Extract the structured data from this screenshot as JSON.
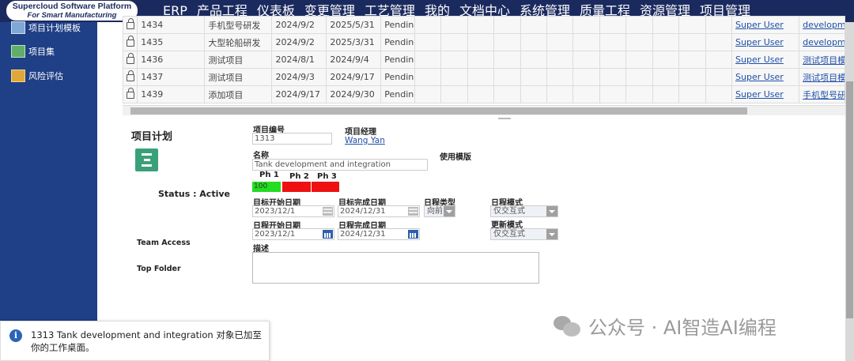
{
  "brand": {
    "line1": "Supercloud Software Platform",
    "line2": "For Smart Manufacturing"
  },
  "top_menu": [
    "ERP",
    "产品工程",
    "仪表板",
    "变更管理",
    "工艺管理",
    "我的",
    "文档中心",
    "系统管理",
    "质量工程",
    "资源管理",
    "项目管理"
  ],
  "sidebar": {
    "items": [
      {
        "label": "项目计划模板",
        "icon": "template-icon"
      },
      {
        "label": "项目集",
        "icon": "program-icon"
      },
      {
        "label": "风险评估",
        "icon": "risk-icon"
      }
    ]
  },
  "table": {
    "rows": [
      {
        "id": "1434",
        "name": "手机型号研发",
        "start": "2024/9/2",
        "end": "2025/5/31",
        "state": "Pending",
        "owner": "Super User",
        "template": "developme"
      },
      {
        "id": "1435",
        "name": "大型轮船研发",
        "start": "2024/9/2",
        "end": "2025/3/31",
        "state": "Pending",
        "owner": "Super User",
        "template": "developme"
      },
      {
        "id": "1436",
        "name": "测试项目",
        "start": "2024/8/1",
        "end": "2024/9/4",
        "state": "Pending",
        "owner": "Super User",
        "template": "测试项目模"
      },
      {
        "id": "1437",
        "name": "测试项目",
        "start": "2024/9/3",
        "end": "2024/9/17",
        "state": "Pending",
        "owner": "Super User",
        "template": "测试项目模"
      },
      {
        "id": "1439",
        "name": "添加项目",
        "start": "2024/9/17",
        "end": "2024/9/30",
        "state": "Pending",
        "owner": "Super User",
        "template": "手机型号研"
      }
    ]
  },
  "form": {
    "section_title": "项目计划",
    "status_label": "Status : Active",
    "team_access_label": "Team Access",
    "top_folder_label": "Top Folder",
    "project_no_label": "项目编号",
    "project_no_value": "1313",
    "manager_label": "项目经理",
    "manager_value": "Wang Yan",
    "name_label": "名称",
    "name_value": "Tank development and integration",
    "use_template_label": "使用模版",
    "phases": [
      {
        "label": "Ph 1",
        "value": "100",
        "color": "#22dd22"
      },
      {
        "label": "Ph 2",
        "value": "",
        "color": "#ee1111"
      },
      {
        "label": "Ph 3",
        "value": "",
        "color": "#ee1111"
      }
    ],
    "target_start_label": "目标开始日期",
    "target_start_value": "2023/12/1",
    "target_end_label": "目标完成日期",
    "target_end_value": "2024/12/31",
    "schedule_type_label": "日程类型",
    "schedule_type_value": "向前",
    "schedule_mode_label": "日程模式",
    "schedule_mode_value": "仅交互式",
    "sched_start_label": "日程开始日期",
    "sched_start_value": "2023/12/1",
    "sched_end_label": "日程完成日期",
    "sched_end_value": "2024/12/31",
    "update_mode_label": "更新模式",
    "update_mode_value": "仅交互式",
    "description_label": "描述"
  },
  "toast": {
    "message": "1313 Tank development and integration 对象已加至你的工作桌面。"
  },
  "watermark": "公众号 · AI智造AI编程"
}
